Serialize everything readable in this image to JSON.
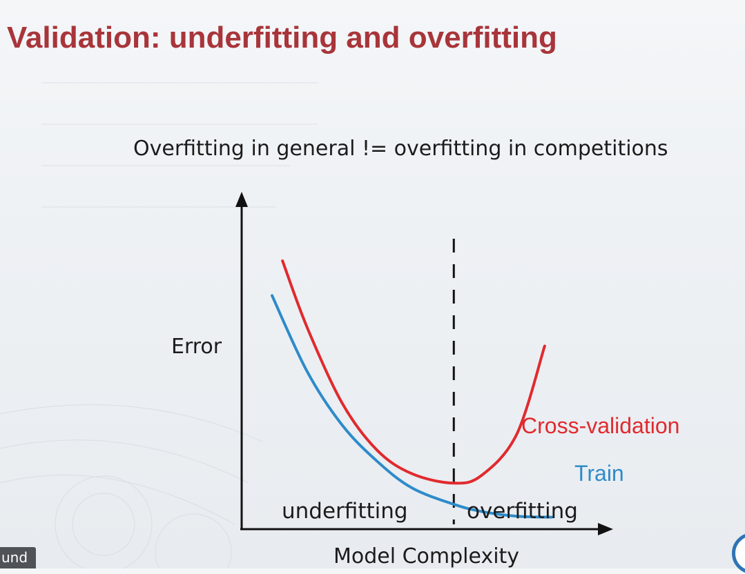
{
  "slide": {
    "title": "Validation: underfitting and overfitting",
    "subtitle": "Overfitting in general != overfitting in competitions"
  },
  "overlay": {
    "caption_fragment": "und"
  },
  "colors": {
    "title": "#a8353a",
    "cv": "#e02a2e",
    "train": "#2e8bc9",
    "axis": "#111111"
  },
  "chart_data": {
    "type": "line",
    "xlabel": "Model Complexity",
    "ylabel": "Error",
    "xlim": [
      0,
      10
    ],
    "ylim": [
      0,
      10
    ],
    "grid": false,
    "series": [
      {
        "name": "Cross-validation",
        "color": "#e02a2e",
        "x": [
          0.3,
          1.0,
          2.0,
          3.0,
          4.0,
          5.2,
          6.0,
          7.0,
          7.8
        ],
        "y": [
          8.4,
          6.3,
          3.9,
          2.4,
          1.65,
          1.35,
          1.6,
          2.9,
          5.7
        ]
      },
      {
        "name": "Train",
        "color": "#2e8bc9",
        "x": [
          0.0,
          1.0,
          2.0,
          3.0,
          4.0,
          5.2,
          6.0,
          7.0,
          8.0
        ],
        "y": [
          7.3,
          4.9,
          3.2,
          2.05,
          1.2,
          0.68,
          0.45,
          0.3,
          0.27
        ]
      }
    ],
    "annotations": [
      {
        "text": "underfitting",
        "x": 1.8,
        "y": 0.45
      },
      {
        "text": "overfitting",
        "x": 6.9,
        "y": 0.45
      }
    ],
    "vline": {
      "x": 5.2,
      "style": "dashed"
    }
  }
}
